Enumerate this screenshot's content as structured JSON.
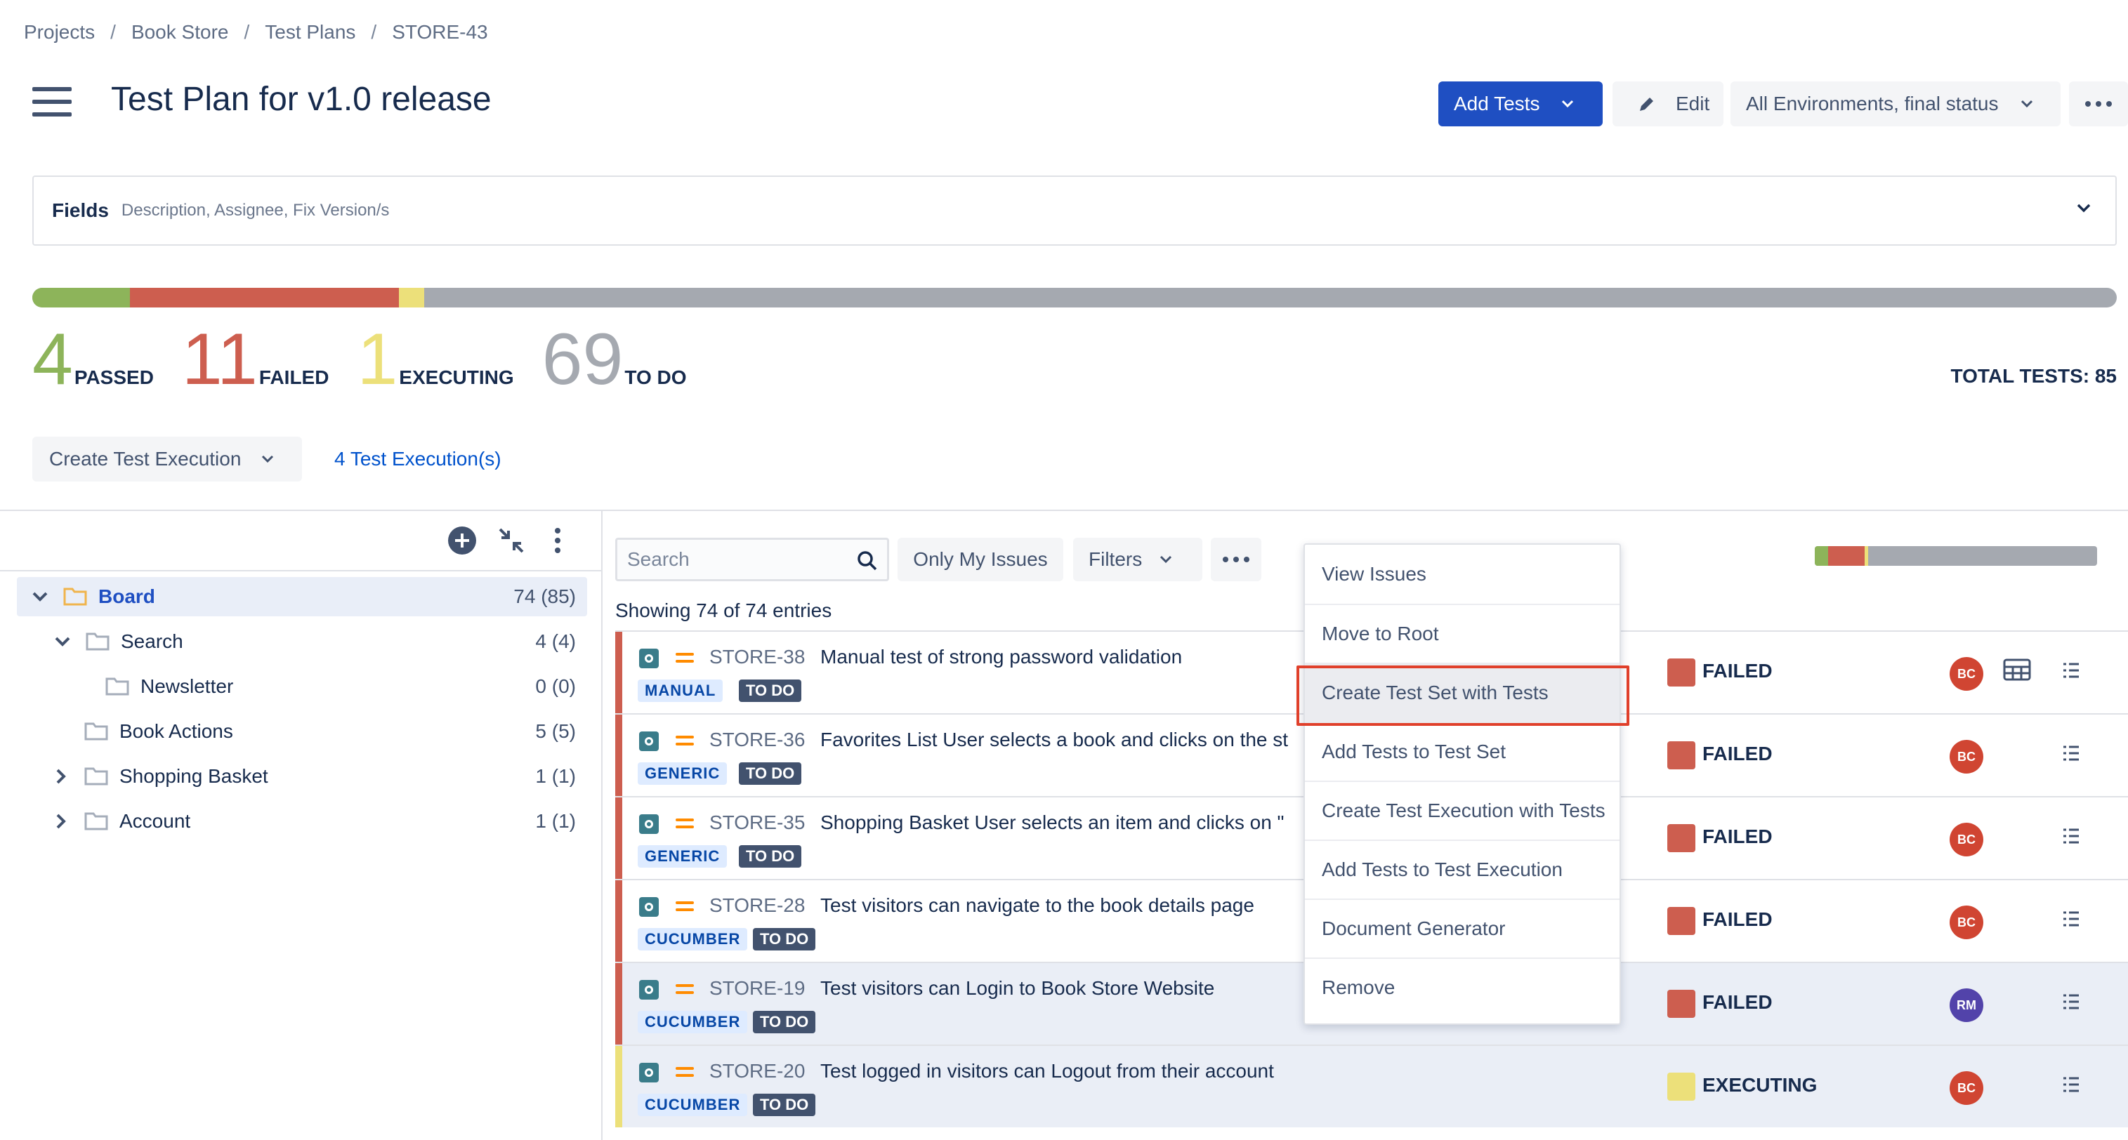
{
  "breadcrumb": {
    "items": [
      "Projects",
      "Book Store",
      "Test Plans",
      "STORE-43"
    ],
    "separator": "/"
  },
  "header": {
    "title": "Test Plan for v1.0 release",
    "add_tests_label": "Add Tests",
    "edit_label": "Edit",
    "environment_label": "All Environments, final status"
  },
  "fields": {
    "title": "Fields",
    "subtitle": "Description, Assignee, Fix Version/s"
  },
  "summary": {
    "passed": {
      "count": "4",
      "label": "PASSED",
      "color": "#8db45a"
    },
    "failed": {
      "count": "11",
      "label": "FAILED",
      "color": "#cd5e4f"
    },
    "executing": {
      "count": "1",
      "label": "EXECUTING",
      "color": "#ece07a"
    },
    "todo": {
      "count": "69",
      "label": "TO DO",
      "color": "#a5a9b0"
    },
    "total_label": "TOTAL TESTS: 85",
    "progress_fractions": {
      "passed": 0.047,
      "failed": 0.129,
      "executing": 0.012,
      "todo": 0.812
    }
  },
  "executions": {
    "create_label": "Create Test Execution",
    "link_label": "4 Test Execution(s)"
  },
  "tree": {
    "items": [
      {
        "name": "Board",
        "count": "74 (85)",
        "level": 0,
        "expanded": true,
        "selected": true
      },
      {
        "name": "Search",
        "count": "4 (4)",
        "level": 1,
        "expanded": true,
        "selected": false
      },
      {
        "name": "Newsletter",
        "count": "0 (0)",
        "level": 2,
        "expanded": false,
        "selected": false
      },
      {
        "name": "Book Actions",
        "count": "5 (5)",
        "level": 1,
        "expanded": false,
        "selected": false
      },
      {
        "name": "Shopping Basket",
        "count": "1 (1)",
        "level": 1,
        "expanded": false,
        "selected": false
      },
      {
        "name": "Account",
        "count": "1 (1)",
        "level": 1,
        "expanded": false,
        "selected": false
      }
    ]
  },
  "table": {
    "search_placeholder": "Search",
    "only_my_issues_label": "Only My Issues",
    "filters_label": "Filters",
    "showing_label": "Showing 74 of 74 entries",
    "rows": [
      {
        "key": "STORE-38",
        "summary": "Manual test of strong password validation",
        "type": "MANUAL",
        "state": "TO DO",
        "status": "FAILED",
        "status_color": "#cd5e4f",
        "assignee": "BC",
        "avatar_color": "#d04532",
        "highlight": false
      },
      {
        "key": "STORE-36",
        "summary": "Favorites List User selects a book and clicks on the st",
        "type": "GENERIC",
        "state": "TO DO",
        "status": "FAILED",
        "status_color": "#cd5e4f",
        "assignee": "BC",
        "avatar_color": "#d04532",
        "highlight": false
      },
      {
        "key": "STORE-35",
        "summary": "Shopping Basket User selects an item and clicks on \"",
        "type": "GENERIC",
        "state": "TO DO",
        "status": "FAILED",
        "status_color": "#cd5e4f",
        "assignee": "BC",
        "avatar_color": "#d04532",
        "highlight": false
      },
      {
        "key": "STORE-28",
        "summary": "Test visitors can navigate to the book details page",
        "type": "CUCUMBER",
        "state": "TO DO",
        "status": "FAILED",
        "status_color": "#cd5e4f",
        "assignee": "BC",
        "avatar_color": "#d04532",
        "highlight": false
      },
      {
        "key": "STORE-19",
        "summary": "Test visitors can Login to Book Store Website",
        "type": "CUCUMBER",
        "state": "TO DO",
        "status": "FAILED",
        "status_color": "#cd5e4f",
        "assignee": "RM",
        "avatar_color": "#5243aa",
        "highlight": true
      },
      {
        "key": "STORE-20",
        "summary": "Test logged in visitors can Logout from their account",
        "type": "CUCUMBER",
        "state": "TO DO",
        "status": "EXECUTING",
        "status_color": "#ece07a",
        "assignee": "BC",
        "avatar_color": "#d04532",
        "highlight": true
      }
    ]
  },
  "context_menu": {
    "items": [
      "View Issues",
      "Move to Root",
      "Create Test Set with Tests",
      "Add Tests to Test Set",
      "Create Test Execution with Tests",
      "Add Tests to Test Execution",
      "Document Generator",
      "Remove"
    ],
    "active_index": 2
  }
}
